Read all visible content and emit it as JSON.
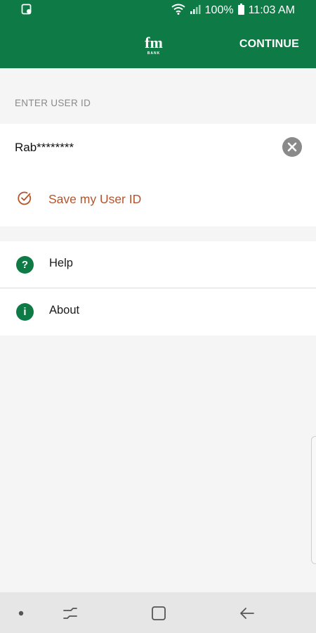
{
  "status_bar": {
    "battery": "100%",
    "time": "11:03 AM"
  },
  "app_bar": {
    "logo_text": "fm",
    "logo_subtext": "BANK",
    "continue_label": "CONTINUE"
  },
  "user_section": {
    "label": "ENTER USER ID",
    "value": "Rab********",
    "save_label": "Save my User ID"
  },
  "menu": {
    "items": [
      {
        "label": "Help",
        "icon": "?"
      },
      {
        "label": "About",
        "icon": "i"
      }
    ]
  },
  "colors": {
    "brand_green": "#0e7a45",
    "save_accent": "#b5542c"
  }
}
